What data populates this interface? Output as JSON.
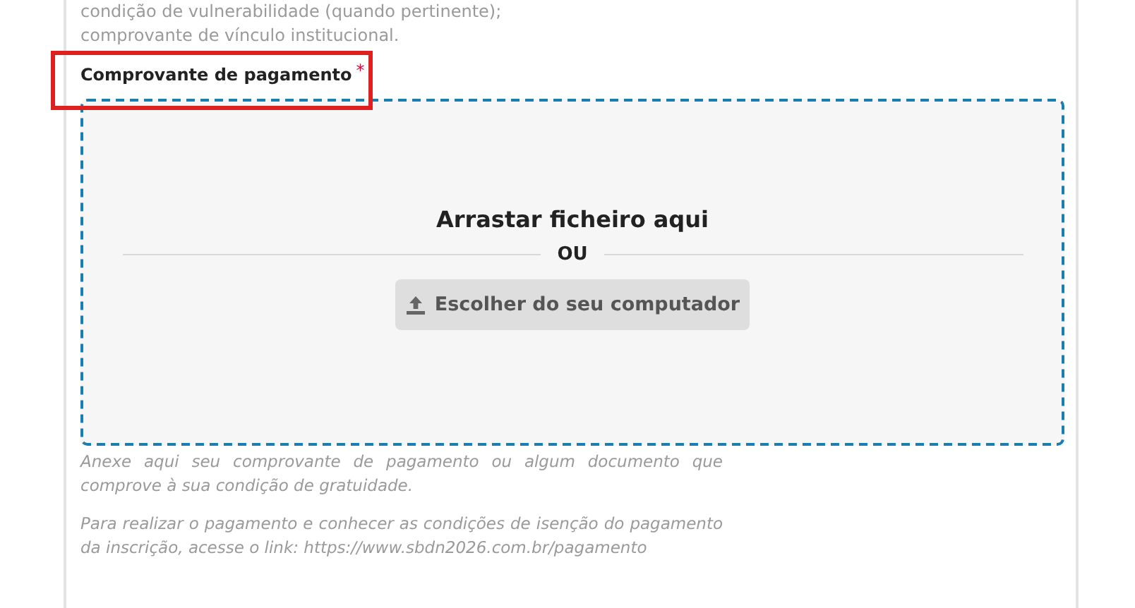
{
  "list_items": [
    "condição de vulnerabilidade (quando pertinente);",
    "comprovante de vínculo institucional."
  ],
  "field": {
    "label": "Comprovante de pagamento",
    "required_mark": "*",
    "required": true,
    "highlighted": true
  },
  "dropzone": {
    "title": "Arrastar ficheiro aqui",
    "separator": "OU",
    "button": "Escolher do seu computador"
  },
  "help": [
    "Anexe aqui seu comprovante de pagamento ou algum documento que comprove à sua condição de gratuidade.",
    "Para realizar o pagamento e conhecer as condições de isenção do pagamento da inscrição, acesse o link: https://www.sbdn2026.com.br/pagamento"
  ]
}
